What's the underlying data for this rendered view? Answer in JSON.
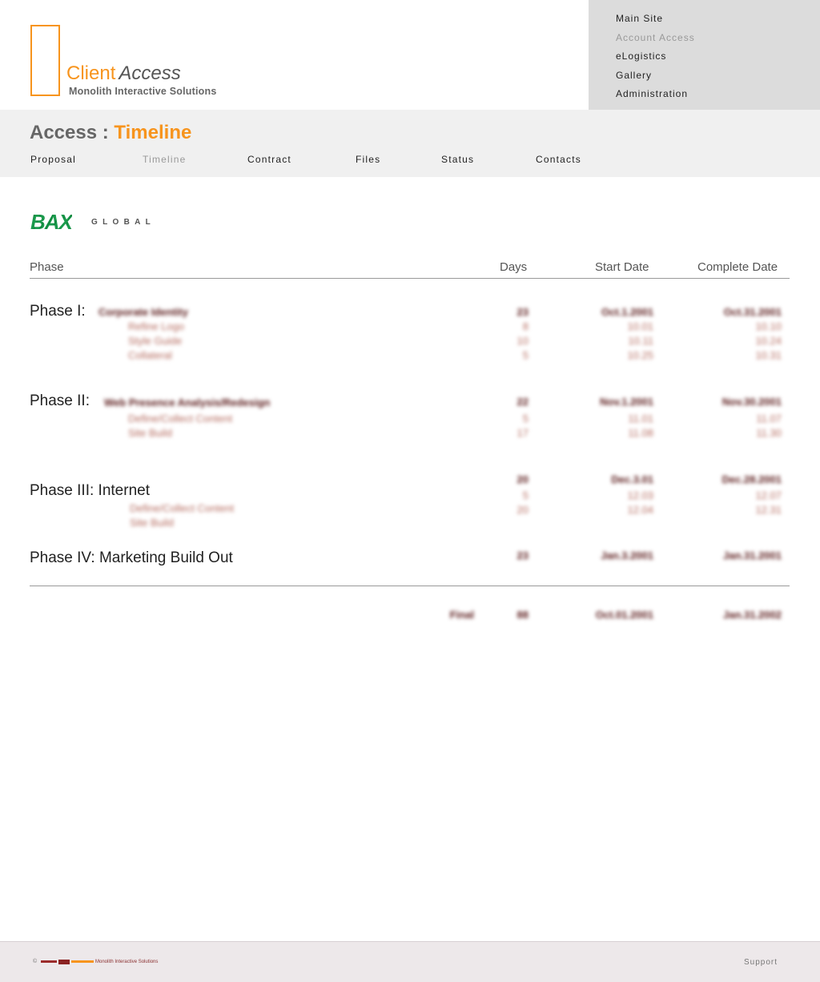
{
  "header": {
    "logo_client": "Client",
    "logo_access": "Access",
    "logo_company": "Monolith Interactive Solutions"
  },
  "top_nav": {
    "items": [
      {
        "label": "Main Site",
        "active": false
      },
      {
        "label": "Account Access",
        "active": true
      },
      {
        "label": "eLogistics",
        "active": false
      },
      {
        "label": "Gallery",
        "active": false
      },
      {
        "label": "Administration",
        "active": false
      }
    ]
  },
  "section": {
    "title_prefix": "Access :",
    "title_current": "Timeline",
    "tabs": [
      {
        "label": "Proposal",
        "active": false
      },
      {
        "label": "Timeline",
        "active": true
      },
      {
        "label": "Contract",
        "active": false
      },
      {
        "label": "Files",
        "active": false
      },
      {
        "label": "Status",
        "active": false
      },
      {
        "label": "Contacts",
        "active": false
      }
    ]
  },
  "client_logo": {
    "mark": "BAX",
    "word": "GLOBAL"
  },
  "table": {
    "headers": {
      "phase": "Phase",
      "days": "Days",
      "start": "Start Date",
      "complete": "Complete Date"
    },
    "phases": [
      {
        "label": "Phase I:",
        "name": "Corporate Identity",
        "days": "23",
        "start": "Oct.1.2001",
        "complete": "Oct.31.2001",
        "tasks": [
          {
            "name": "Refine Logo",
            "days": "8",
            "start": "10.01",
            "complete": "10.10"
          },
          {
            "name": "Style Guide",
            "days": "10",
            "start": "10.11",
            "complete": "10.24"
          },
          {
            "name": "Collateral",
            "days": "5",
            "start": "10.25",
            "complete": "10.31"
          }
        ]
      },
      {
        "label": "Phase II:",
        "name": "Web Presence Analysis/Redesign",
        "days": "22",
        "start": "Nov.1.2001",
        "complete": "Nov.30.2001",
        "tasks": [
          {
            "name": "Define/Collect Content",
            "days": "5",
            "start": "11.01",
            "complete": "11.07"
          },
          {
            "name": "Site Build",
            "days": "17",
            "start": "11.08",
            "complete": "11.30"
          }
        ]
      },
      {
        "label": "Phase III: Internet",
        "name": "",
        "days": "20",
        "start": "Dec.3.01",
        "complete": "Dec.28.2001",
        "tasks": [
          {
            "name": "Define/Collect Content",
            "days": "5",
            "start": "12.03",
            "complete": "12.07"
          },
          {
            "name": "Site Build",
            "days": "20",
            "start": "12.04",
            "complete": "12.31"
          }
        ]
      },
      {
        "label": "Phase IV: Marketing Build Out",
        "name": "",
        "days": "23",
        "start": "Jan.3.2001",
        "complete": "Jan.31.2001",
        "tasks": []
      }
    ],
    "total": {
      "label": "Final",
      "days": "88",
      "start": "Oct.01.2001",
      "complete": "Jan.31.2002"
    }
  },
  "footer": {
    "copyright": "©",
    "brand": "Monolith Interactive Solutions",
    "support": "Support"
  }
}
